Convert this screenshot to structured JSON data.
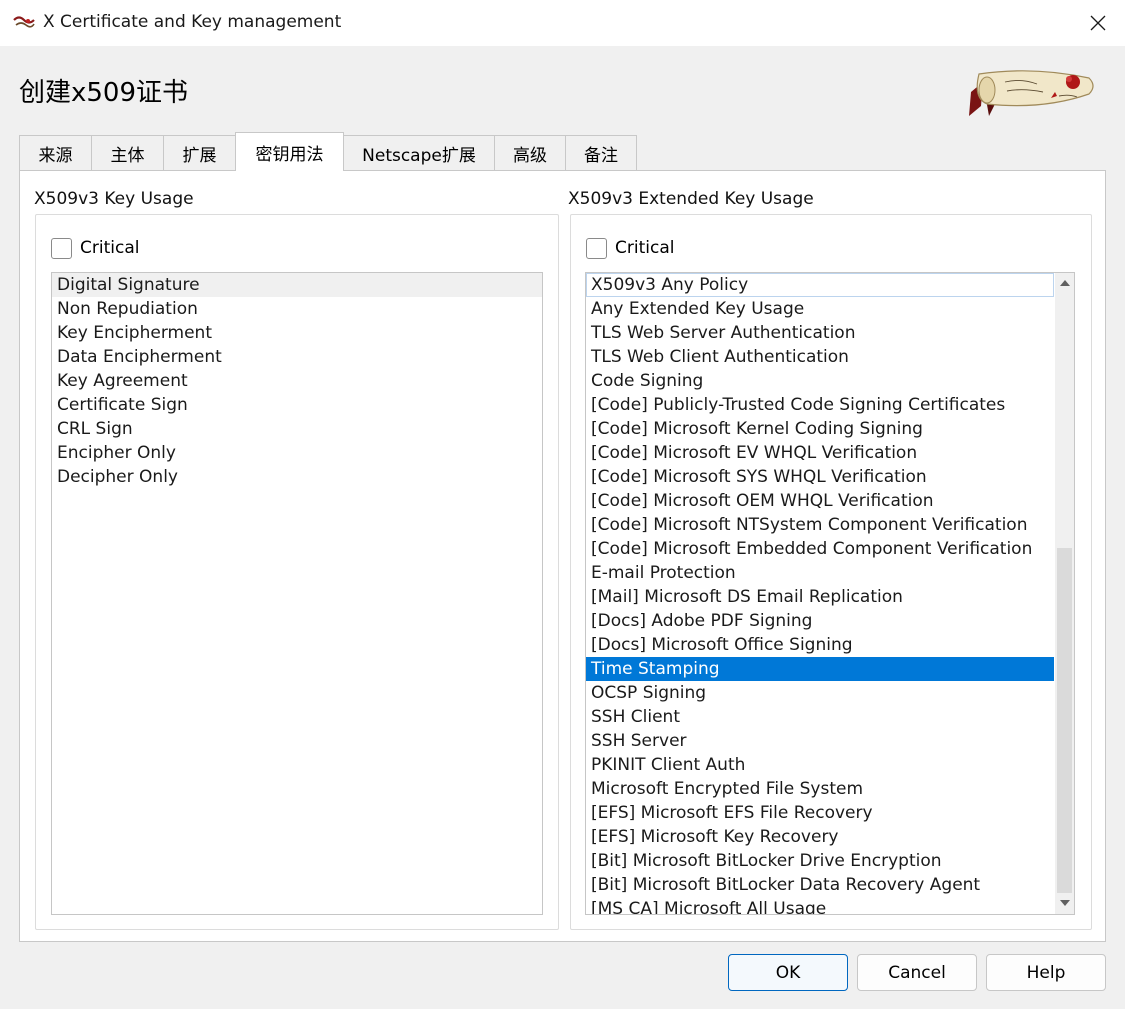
{
  "window": {
    "title": "X Certificate and Key management"
  },
  "page_title": "创建x509证书",
  "tabs": [
    {
      "label": "来源"
    },
    {
      "label": "主体"
    },
    {
      "label": "扩展"
    },
    {
      "label": "密钥用法",
      "active": true
    },
    {
      "label": "Netscape扩展"
    },
    {
      "label": "高级"
    },
    {
      "label": "备注"
    }
  ],
  "key_usage": {
    "label": "X509v3 Key Usage",
    "critical_label": "Critical",
    "critical_checked": false,
    "items": [
      "Digital Signature",
      "Non Repudiation",
      "Key Encipherment",
      "Data Encipherment",
      "Key Agreement",
      "Certificate Sign",
      "CRL Sign",
      "Encipher Only",
      "Decipher Only"
    ]
  },
  "extended_key_usage": {
    "label": "X509v3 Extended Key Usage",
    "critical_label": "Critical",
    "critical_checked": false,
    "selected": "Time Stamping",
    "items": [
      "X509v3 Any Policy",
      "Any Extended Key Usage",
      "TLS Web Server Authentication",
      "TLS Web Client Authentication",
      "Code Signing",
      "[Code] Publicly-Trusted Code Signing Certificates",
      "[Code] Microsoft Kernel Coding Signing",
      "[Code] Microsoft EV WHQL Verification",
      "[Code] Microsoft SYS WHQL Verification",
      "[Code] Microsoft OEM WHQL Verification",
      "[Code] Microsoft NTSystem Component Verification",
      "[Code] Microsoft Embedded Component Verification",
      "E-mail Protection",
      "[Mail] Microsoft DS Email Replication",
      "[Docs] Adobe PDF Signing",
      "[Docs] Microsoft Office Signing",
      "Time Stamping",
      "OCSP Signing",
      "SSH Client",
      "SSH Server",
      "PKINIT Client Auth",
      "Microsoft Encrypted File System",
      "[EFS] Microsoft EFS File Recovery",
      "[EFS] Microsoft Key Recovery",
      "[Bit] Microsoft BitLocker Drive Encryption",
      "[Bit] Microsoft BitLocker Data Recovery Agent",
      "[MS CA] Microsoft All Usage"
    ]
  },
  "buttons": {
    "ok": "OK",
    "cancel": "Cancel",
    "help": "Help"
  },
  "icons": {
    "app": "xca-scroll-icon",
    "close": "close-icon",
    "logo": "xca-scroll-logo"
  },
  "colors": {
    "selection": "#0078d7",
    "default_button_border": "#0067c0"
  }
}
